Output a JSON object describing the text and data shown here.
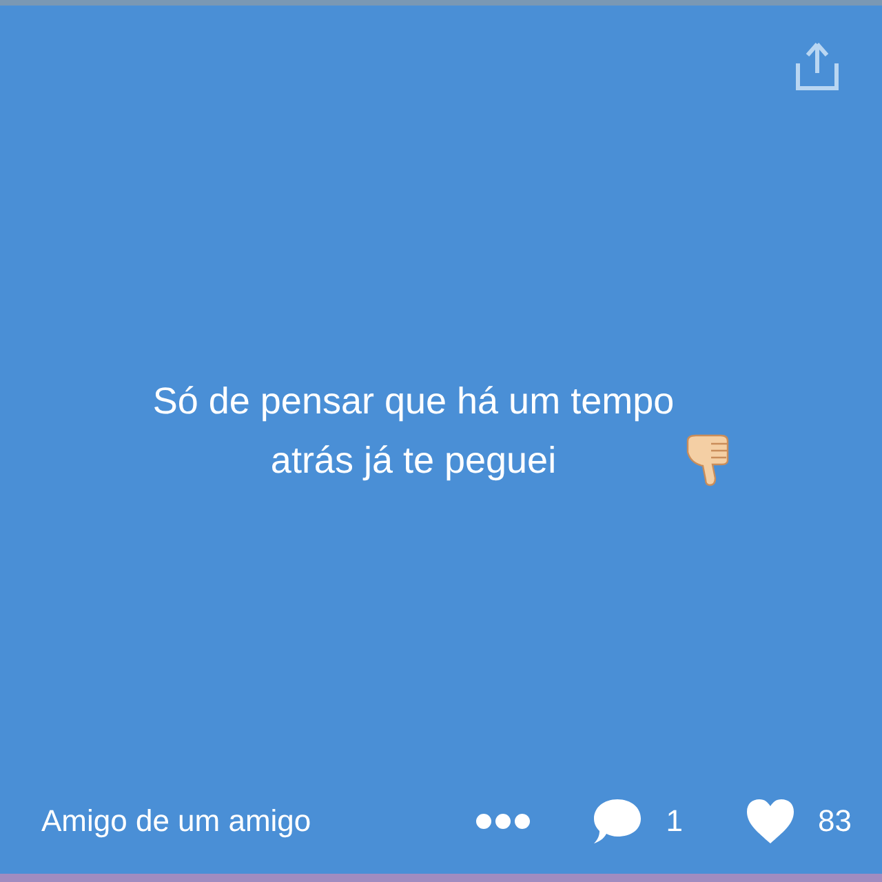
{
  "post": {
    "text": "Só de pensar que há um tempo atrás já te peguei"
  },
  "footer": {
    "relation": "Amigo de um amigo",
    "replies": "1",
    "hearts": "83"
  }
}
